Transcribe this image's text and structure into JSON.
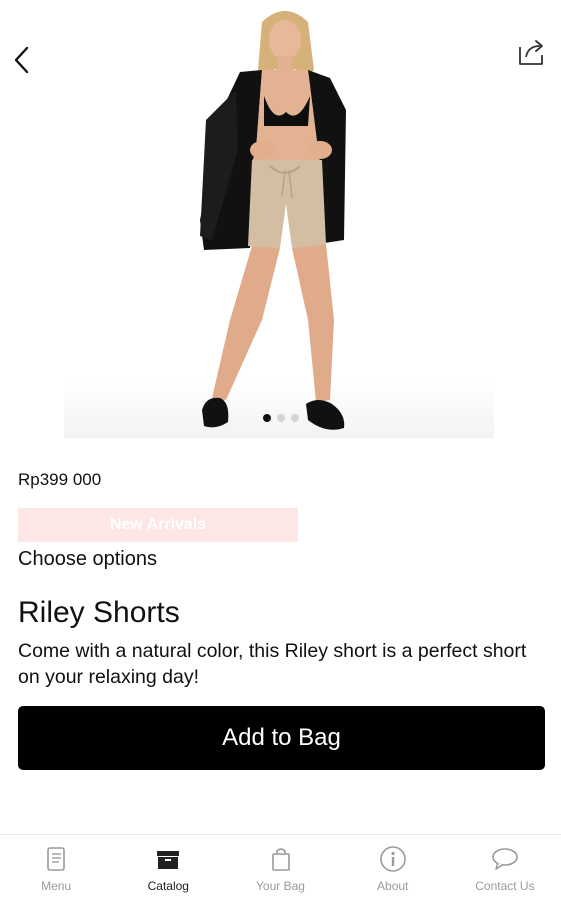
{
  "header": {
    "back_icon": "chevron-left-icon",
    "share_icon": "share-icon"
  },
  "gallery": {
    "image_count": 3,
    "active_index": 0
  },
  "product": {
    "price": "Rp399 000",
    "badge": "New Arrivals",
    "options_label": "Choose options",
    "title": "Riley Shorts",
    "description": "Come with a natural color, this Riley short is a perfect short on your relaxing day!",
    "add_to_bag_label": "Add to Bag"
  },
  "nav": {
    "items": [
      {
        "label": "Menu",
        "icon": "menu-book-icon",
        "active": false
      },
      {
        "label": "Catalog",
        "icon": "catalog-box-icon",
        "active": true
      },
      {
        "label": "Your Bag",
        "icon": "shopping-bag-icon",
        "active": false
      },
      {
        "label": "About",
        "icon": "info-icon",
        "active": false
      },
      {
        "label": "Contact Us",
        "icon": "chat-bubble-icon",
        "active": false
      }
    ]
  },
  "colors": {
    "primary_button": "#000000",
    "badge_background": "#fde6e6",
    "nav_active": "#222222",
    "nav_inactive": "#9a9a9a"
  }
}
